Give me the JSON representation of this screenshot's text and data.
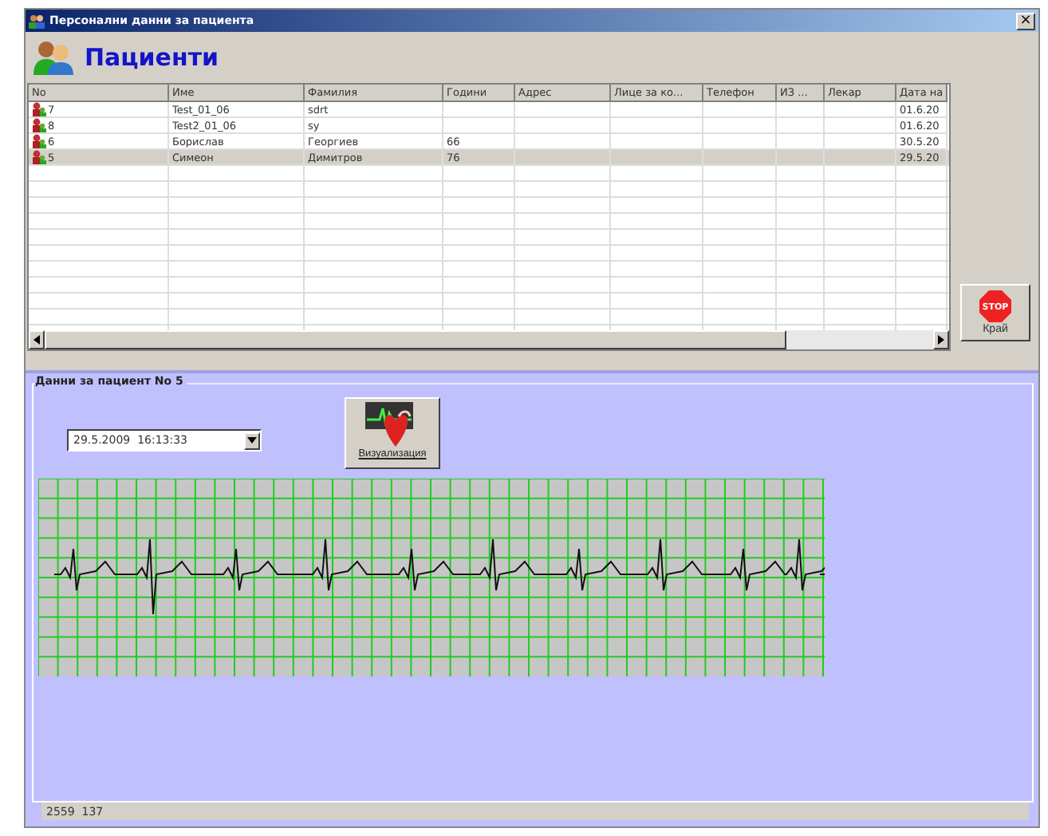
{
  "window": {
    "title": "Персонални данни за пациента",
    "close": "×"
  },
  "header": {
    "title": "Пациенти"
  },
  "table": {
    "columns": [
      "No",
      "Име",
      "Фамилия",
      "Години",
      "Адрес",
      "Лице за ко...",
      "Телефон",
      "ИЗ ...",
      "Лекар",
      "Дата на"
    ],
    "rows": [
      {
        "cells": [
          "7",
          "Test_01_06",
          "sdrt",
          "",
          "",
          "",
          "",
          "",
          "",
          "01.6.20"
        ],
        "selected": false
      },
      {
        "cells": [
          "8",
          "Test2_01_06",
          "sy",
          "",
          "",
          "",
          "",
          "",
          "",
          "01.6.20"
        ],
        "selected": false
      },
      {
        "cells": [
          "6",
          "Борислав",
          "Георгиев",
          "66",
          "",
          "",
          "",
          "",
          "",
          "30.5.20"
        ],
        "selected": false
      },
      {
        "cells": [
          "5",
          "Симеон",
          "Димитров",
          "76",
          "",
          "",
          "",
          "",
          "",
          "29.5.20"
        ],
        "selected": true
      }
    ]
  },
  "exit_button": {
    "label": "Край",
    "icon_text": "STOP"
  },
  "patient_panel": {
    "legend": "Данни за пациент No 5",
    "record_select": {
      "value": "29.5.2009  16:13:33"
    },
    "visualize_button": {
      "label": "Визуализация"
    }
  },
  "status_bar": {
    "text": "2559  137"
  }
}
